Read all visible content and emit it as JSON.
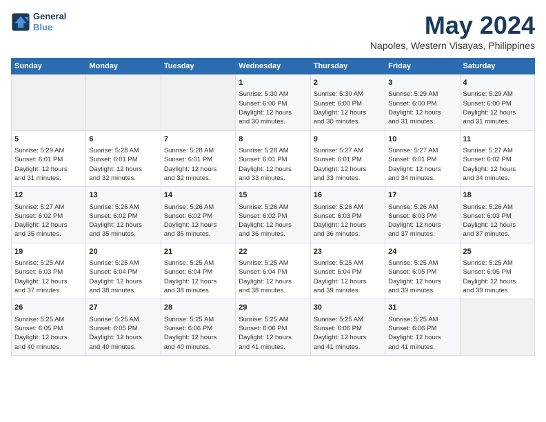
{
  "header": {
    "logo_line1": "General",
    "logo_line2": "Blue",
    "month": "May 2024",
    "location": "Napoles, Western Visayas, Philippines"
  },
  "weekdays": [
    "Sunday",
    "Monday",
    "Tuesday",
    "Wednesday",
    "Thursday",
    "Friday",
    "Saturday"
  ],
  "weeks": [
    [
      {
        "day": "",
        "info": ""
      },
      {
        "day": "",
        "info": ""
      },
      {
        "day": "",
        "info": ""
      },
      {
        "day": "1",
        "info": "Sunrise: 5:30 AM\nSunset: 6:00 PM\nDaylight: 12 hours\nand 30 minutes."
      },
      {
        "day": "2",
        "info": "Sunrise: 5:30 AM\nSunset: 6:00 PM\nDaylight: 12 hours\nand 30 minutes."
      },
      {
        "day": "3",
        "info": "Sunrise: 5:29 AM\nSunset: 6:00 PM\nDaylight: 12 hours\nand 31 minutes."
      },
      {
        "day": "4",
        "info": "Sunrise: 5:29 AM\nSunset: 6:00 PM\nDaylight: 12 hours\nand 31 minutes."
      }
    ],
    [
      {
        "day": "5",
        "info": "Sunrise: 5:29 AM\nSunset: 6:01 PM\nDaylight: 12 hours\nand 31 minutes."
      },
      {
        "day": "6",
        "info": "Sunrise: 5:28 AM\nSunset: 6:01 PM\nDaylight: 12 hours\nand 32 minutes."
      },
      {
        "day": "7",
        "info": "Sunrise: 5:28 AM\nSunset: 6:01 PM\nDaylight: 12 hours\nand 32 minutes."
      },
      {
        "day": "8",
        "info": "Sunrise: 5:28 AM\nSunset: 6:01 PM\nDaylight: 12 hours\nand 33 minutes."
      },
      {
        "day": "9",
        "info": "Sunrise: 5:27 AM\nSunset: 6:01 PM\nDaylight: 12 hours\nand 33 minutes."
      },
      {
        "day": "10",
        "info": "Sunrise: 5:27 AM\nSunset: 6:01 PM\nDaylight: 12 hours\nand 34 minutes."
      },
      {
        "day": "11",
        "info": "Sunrise: 5:27 AM\nSunset: 6:02 PM\nDaylight: 12 hours\nand 34 minutes."
      }
    ],
    [
      {
        "day": "12",
        "info": "Sunrise: 5:27 AM\nSunset: 6:02 PM\nDaylight: 12 hours\nand 35 minutes."
      },
      {
        "day": "13",
        "info": "Sunrise: 5:26 AM\nSunset: 6:02 PM\nDaylight: 12 hours\nand 35 minutes."
      },
      {
        "day": "14",
        "info": "Sunrise: 5:26 AM\nSunset: 6:02 PM\nDaylight: 12 hours\nand 35 minutes."
      },
      {
        "day": "15",
        "info": "Sunrise: 5:26 AM\nSunset: 6:02 PM\nDaylight: 12 hours\nand 36 minutes."
      },
      {
        "day": "16",
        "info": "Sunrise: 5:26 AM\nSunset: 6:03 PM\nDaylight: 12 hours\nand 36 minutes."
      },
      {
        "day": "17",
        "info": "Sunrise: 5:26 AM\nSunset: 6:03 PM\nDaylight: 12 hours\nand 37 minutes."
      },
      {
        "day": "18",
        "info": "Sunrise: 5:26 AM\nSunset: 6:03 PM\nDaylight: 12 hours\nand 37 minutes."
      }
    ],
    [
      {
        "day": "19",
        "info": "Sunrise: 5:25 AM\nSunset: 6:03 PM\nDaylight: 12 hours\nand 37 minutes."
      },
      {
        "day": "20",
        "info": "Sunrise: 5:25 AM\nSunset: 6:04 PM\nDaylight: 12 hours\nand 38 minutes."
      },
      {
        "day": "21",
        "info": "Sunrise: 5:25 AM\nSunset: 6:04 PM\nDaylight: 12 hours\nand 38 minutes."
      },
      {
        "day": "22",
        "info": "Sunrise: 5:25 AM\nSunset: 6:04 PM\nDaylight: 12 hours\nand 38 minutes."
      },
      {
        "day": "23",
        "info": "Sunrise: 5:25 AM\nSunset: 6:04 PM\nDaylight: 12 hours\nand 39 minutes."
      },
      {
        "day": "24",
        "info": "Sunrise: 5:25 AM\nSunset: 6:05 PM\nDaylight: 12 hours\nand 39 minutes."
      },
      {
        "day": "25",
        "info": "Sunrise: 5:25 AM\nSunset: 6:05 PM\nDaylight: 12 hours\nand 39 minutes."
      }
    ],
    [
      {
        "day": "26",
        "info": "Sunrise: 5:25 AM\nSunset: 6:05 PM\nDaylight: 12 hours\nand 40 minutes."
      },
      {
        "day": "27",
        "info": "Sunrise: 5:25 AM\nSunset: 6:05 PM\nDaylight: 12 hours\nand 40 minutes."
      },
      {
        "day": "28",
        "info": "Sunrise: 5:25 AM\nSunset: 6:06 PM\nDaylight: 12 hours\nand 40 minutes."
      },
      {
        "day": "29",
        "info": "Sunrise: 5:25 AM\nSunset: 6:06 PM\nDaylight: 12 hours\nand 41 minutes."
      },
      {
        "day": "30",
        "info": "Sunrise: 5:25 AM\nSunset: 6:06 PM\nDaylight: 12 hours\nand 41 minutes."
      },
      {
        "day": "31",
        "info": "Sunrise: 5:25 AM\nSunset: 6:06 PM\nDaylight: 12 hours\nand 41 minutes."
      },
      {
        "day": "",
        "info": ""
      }
    ]
  ]
}
